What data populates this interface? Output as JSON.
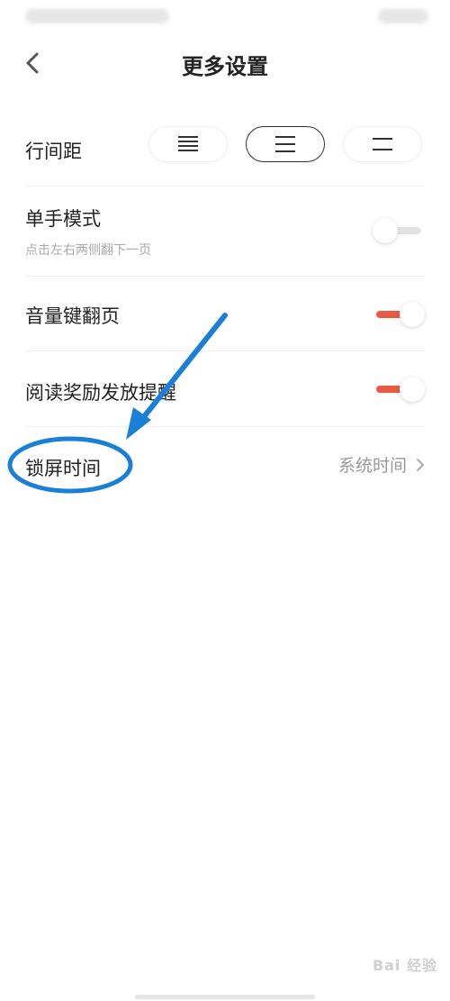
{
  "header": {
    "title": "更多设置",
    "back_icon": "chevron-left-icon"
  },
  "line_spacing": {
    "label": "行间距",
    "options": [
      {
        "icon": "line-spacing-tight-icon",
        "selected": false
      },
      {
        "icon": "line-spacing-medium-icon",
        "selected": true
      },
      {
        "icon": "line-spacing-wide-icon",
        "selected": false
      }
    ]
  },
  "one_hand_mode": {
    "label": "单手模式",
    "subtitle": "点击左右两侧翻下一页",
    "enabled": false
  },
  "volume_key_flip": {
    "label": "音量键翻页",
    "enabled": true
  },
  "reward_reminder": {
    "label": "阅读奖励发放提醒",
    "enabled": true
  },
  "lock_screen_time": {
    "label": "锁屏时间",
    "value": "系统时间",
    "chevron_icon": "chevron-right-icon"
  },
  "watermark": {
    "text": "Bai 经验"
  },
  "colors": {
    "accent": "#e85a42",
    "annotation": "#1a7fd6"
  }
}
